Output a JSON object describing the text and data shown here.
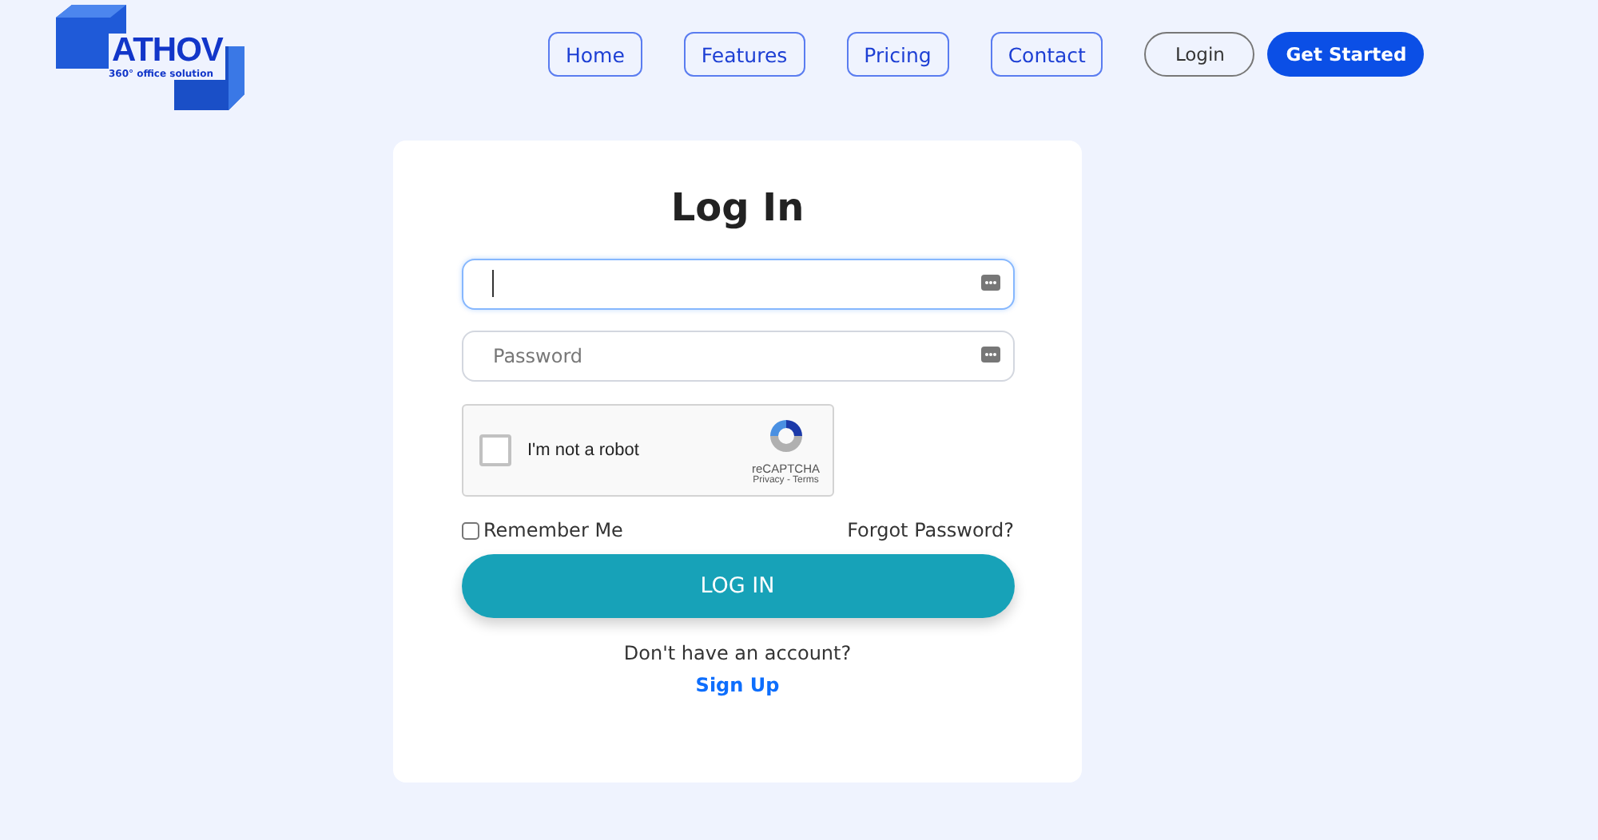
{
  "logo": {
    "name": "ATHOV",
    "tagline": "360° office solution"
  },
  "nav": [
    {
      "label": "Home",
      "kind": "link"
    },
    {
      "label": "Features",
      "kind": "link"
    },
    {
      "label": "Pricing",
      "kind": "link"
    },
    {
      "label": "Contact",
      "kind": "link"
    },
    {
      "label": "Login",
      "kind": "outline"
    },
    {
      "label": "Get Started",
      "kind": "primary"
    }
  ],
  "form": {
    "title": "Log In",
    "username": {
      "focused": true
    },
    "password": {
      "placeholder": "Password"
    },
    "captcha": {
      "label": "I'm not a robot",
      "checked": false,
      "brand": "reCAPTCHA",
      "links": "Privacy - Terms"
    },
    "remember": {
      "label": "Remember Me",
      "checked": false
    },
    "forgot": "Forgot Password?",
    "submit": "LOG IN",
    "prompt": "Don't have an account?",
    "signup": "Sign Up"
  }
}
